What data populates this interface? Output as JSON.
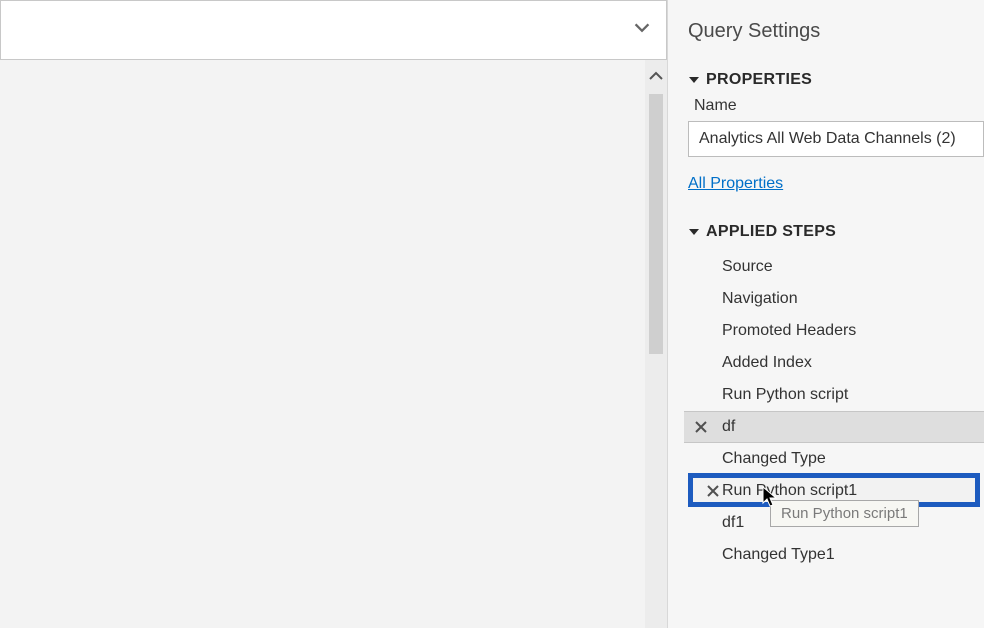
{
  "querySettings": {
    "title": "Query Settings",
    "properties": {
      "header": "PROPERTIES",
      "nameLabel": "Name",
      "nameValue": "Analytics All Web Data Channels (2)",
      "allPropertiesLink": "All Properties"
    },
    "appliedSteps": {
      "header": "APPLIED STEPS",
      "items": [
        {
          "label": "Source",
          "deletable": false
        },
        {
          "label": "Navigation",
          "deletable": false
        },
        {
          "label": "Promoted Headers",
          "deletable": false
        },
        {
          "label": "Added Index",
          "deletable": false
        },
        {
          "label": "Run Python script",
          "deletable": false
        },
        {
          "label": "df",
          "deletable": true,
          "shaded": true
        },
        {
          "label": "Changed Type",
          "deletable": false
        },
        {
          "label": "Run Python script1",
          "deletable": true,
          "highlighted": true
        },
        {
          "label": "df1",
          "deletable": false
        },
        {
          "label": "Changed Type1",
          "deletable": false
        }
      ]
    },
    "tooltip": "Run Python script1"
  }
}
